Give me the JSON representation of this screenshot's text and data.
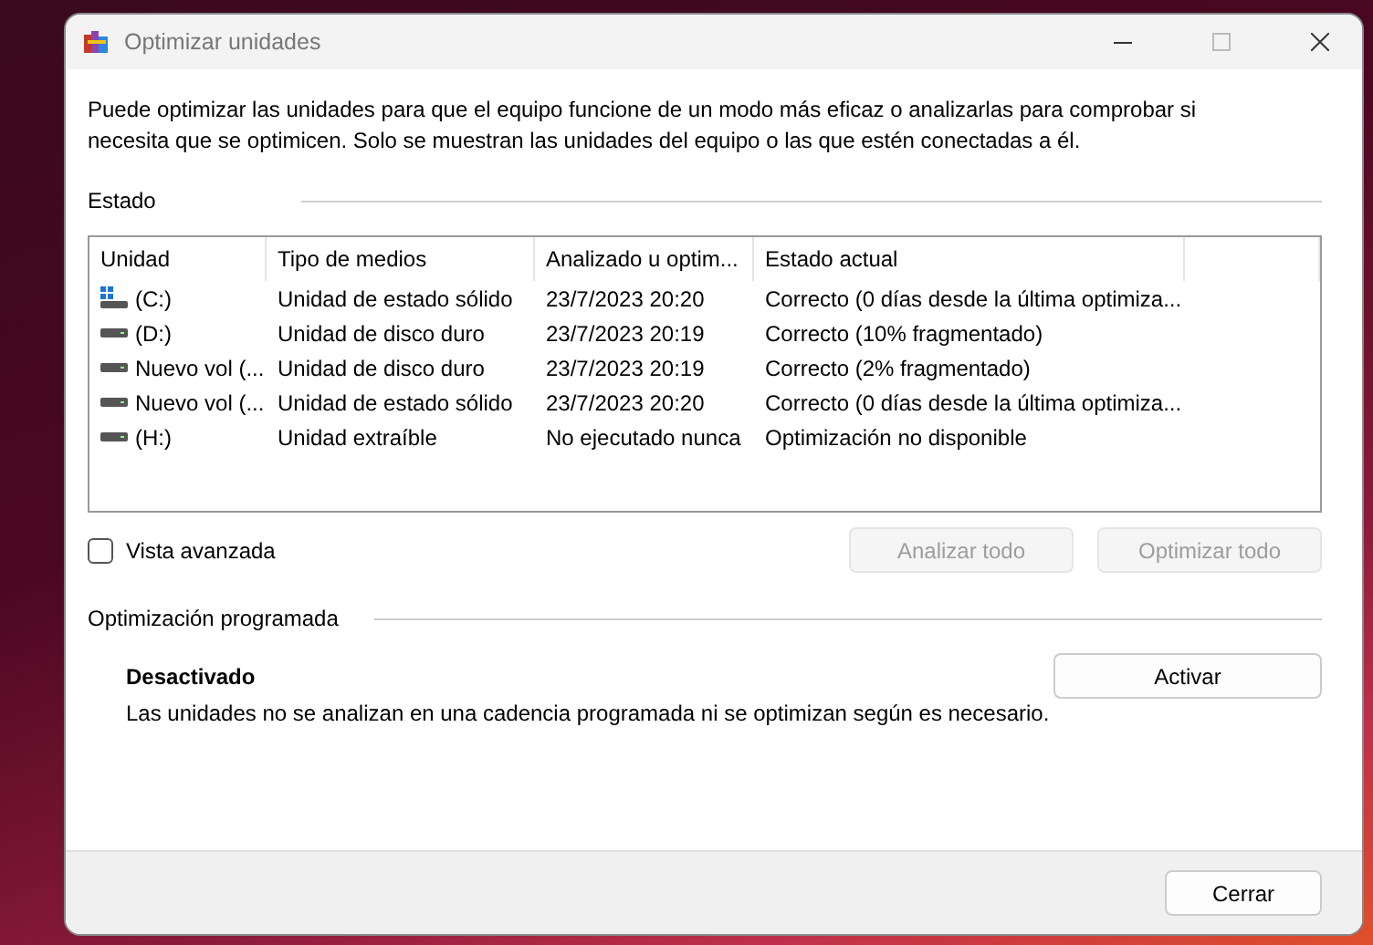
{
  "window": {
    "title": "Optimizar unidades"
  },
  "description": "Puede optimizar las unidades para que el equipo funcione de un modo más eficaz o analizarlas para comprobar si necesita que se optimicen. Solo se muestran las unidades del equipo o las que estén conectadas a él.",
  "status_section": {
    "title": "Estado"
  },
  "table": {
    "columns": [
      "Unidad",
      "Tipo de medios",
      "Analizado u optim...",
      "Estado actual"
    ],
    "rows": [
      {
        "kind": "system",
        "cells": [
          "(C:)",
          "Unidad de estado sólido",
          "23/7/2023 20:20",
          "Correcto (0 días desde la última optimiza..."
        ]
      },
      {
        "kind": "drive",
        "cells": [
          "(D:)",
          "Unidad de disco duro",
          "23/7/2023 20:19",
          "Correcto (10% fragmentado)"
        ]
      },
      {
        "kind": "drive",
        "cells": [
          "Nuevo vol (...",
          "Unidad de disco duro",
          "23/7/2023 20:19",
          "Correcto (2% fragmentado)"
        ]
      },
      {
        "kind": "drive",
        "cells": [
          "Nuevo vol (...",
          "Unidad de estado sólido",
          "23/7/2023 20:20",
          "Correcto (0 días desde la última optimiza..."
        ]
      },
      {
        "kind": "drive",
        "cells": [
          "(H:)",
          "Unidad extraíble",
          "No ejecutado nunca",
          "Optimización no disponible"
        ]
      }
    ]
  },
  "advanced_view": {
    "label": "Vista avanzada",
    "checked": false
  },
  "action_buttons": [
    {
      "label": "Analizar todo",
      "disabled": true
    },
    {
      "label": "Optimizar todo",
      "disabled": true
    }
  ],
  "schedule": {
    "title": "Optimización programada",
    "status": "Desactivado",
    "description": "Las unidades no se analizan en una cadencia programada ni se optimizan según es necesario.",
    "button": "Activar"
  },
  "footer": {
    "button": "Cerrar"
  }
}
